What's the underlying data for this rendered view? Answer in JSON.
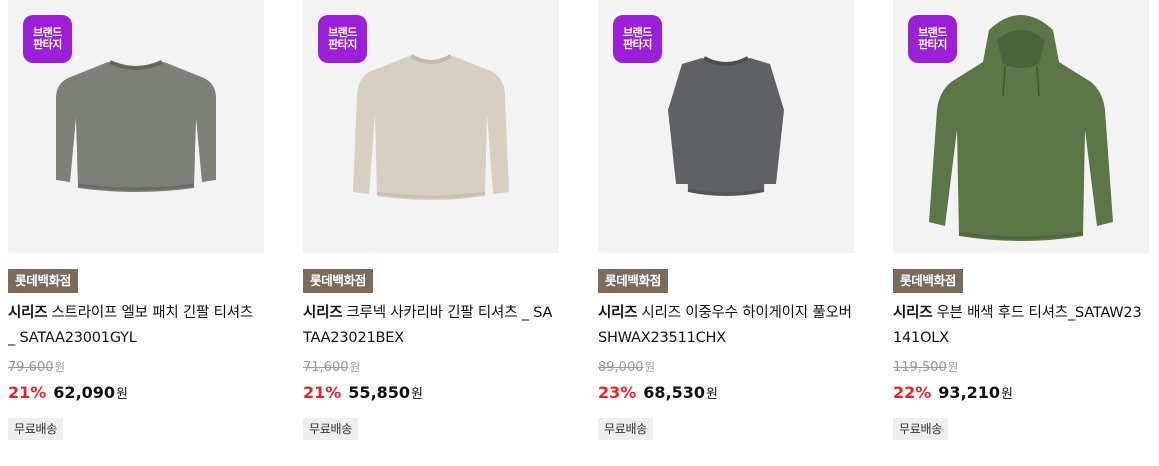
{
  "badge": {
    "line1": "브랜드",
    "line2": "판타지",
    "color": "#9b1fd6"
  },
  "products": [
    {
      "store": "롯데백화점",
      "brand": "시리즈",
      "name": "스트라이프 엘보 패치 긴팔 티셔츠 _ SATAA23001GYL",
      "original_price": "79,600",
      "discount": "21%",
      "sale_price": "62,090",
      "currency": "원",
      "shipping": "무료배송",
      "garment": "sweater-grey"
    },
    {
      "store": "롯데백화점",
      "brand": "시리즈",
      "name": "크루넥 사카리바 긴팔 티셔츠 _ SATAA23021BEX",
      "original_price": "71,600",
      "discount": "21%",
      "sale_price": "55,850",
      "currency": "원",
      "shipping": "무료배송",
      "garment": "sweater-beige"
    },
    {
      "store": "롯데백화점",
      "brand": "시리즈",
      "name": "시리즈 이중우수 하이게이지 풀오버 SHWAX23511CHX",
      "original_price": "89,000",
      "discount": "23%",
      "sale_price": "68,530",
      "currency": "원",
      "shipping": "무료배송",
      "garment": "sweater-charcoal"
    },
    {
      "store": "롯데백화점",
      "brand": "시리즈",
      "name": "우븐 배색 후드 티셔츠_SATAW23141OLX",
      "original_price": "119,500",
      "discount": "22%",
      "sale_price": "93,210",
      "currency": "원",
      "shipping": "무료배송",
      "garment": "hoodie-olive"
    }
  ],
  "colors": {
    "store_tag": "#7a6b5d",
    "discount": "#e8242a",
    "ship_bg": "#eeeeee"
  }
}
